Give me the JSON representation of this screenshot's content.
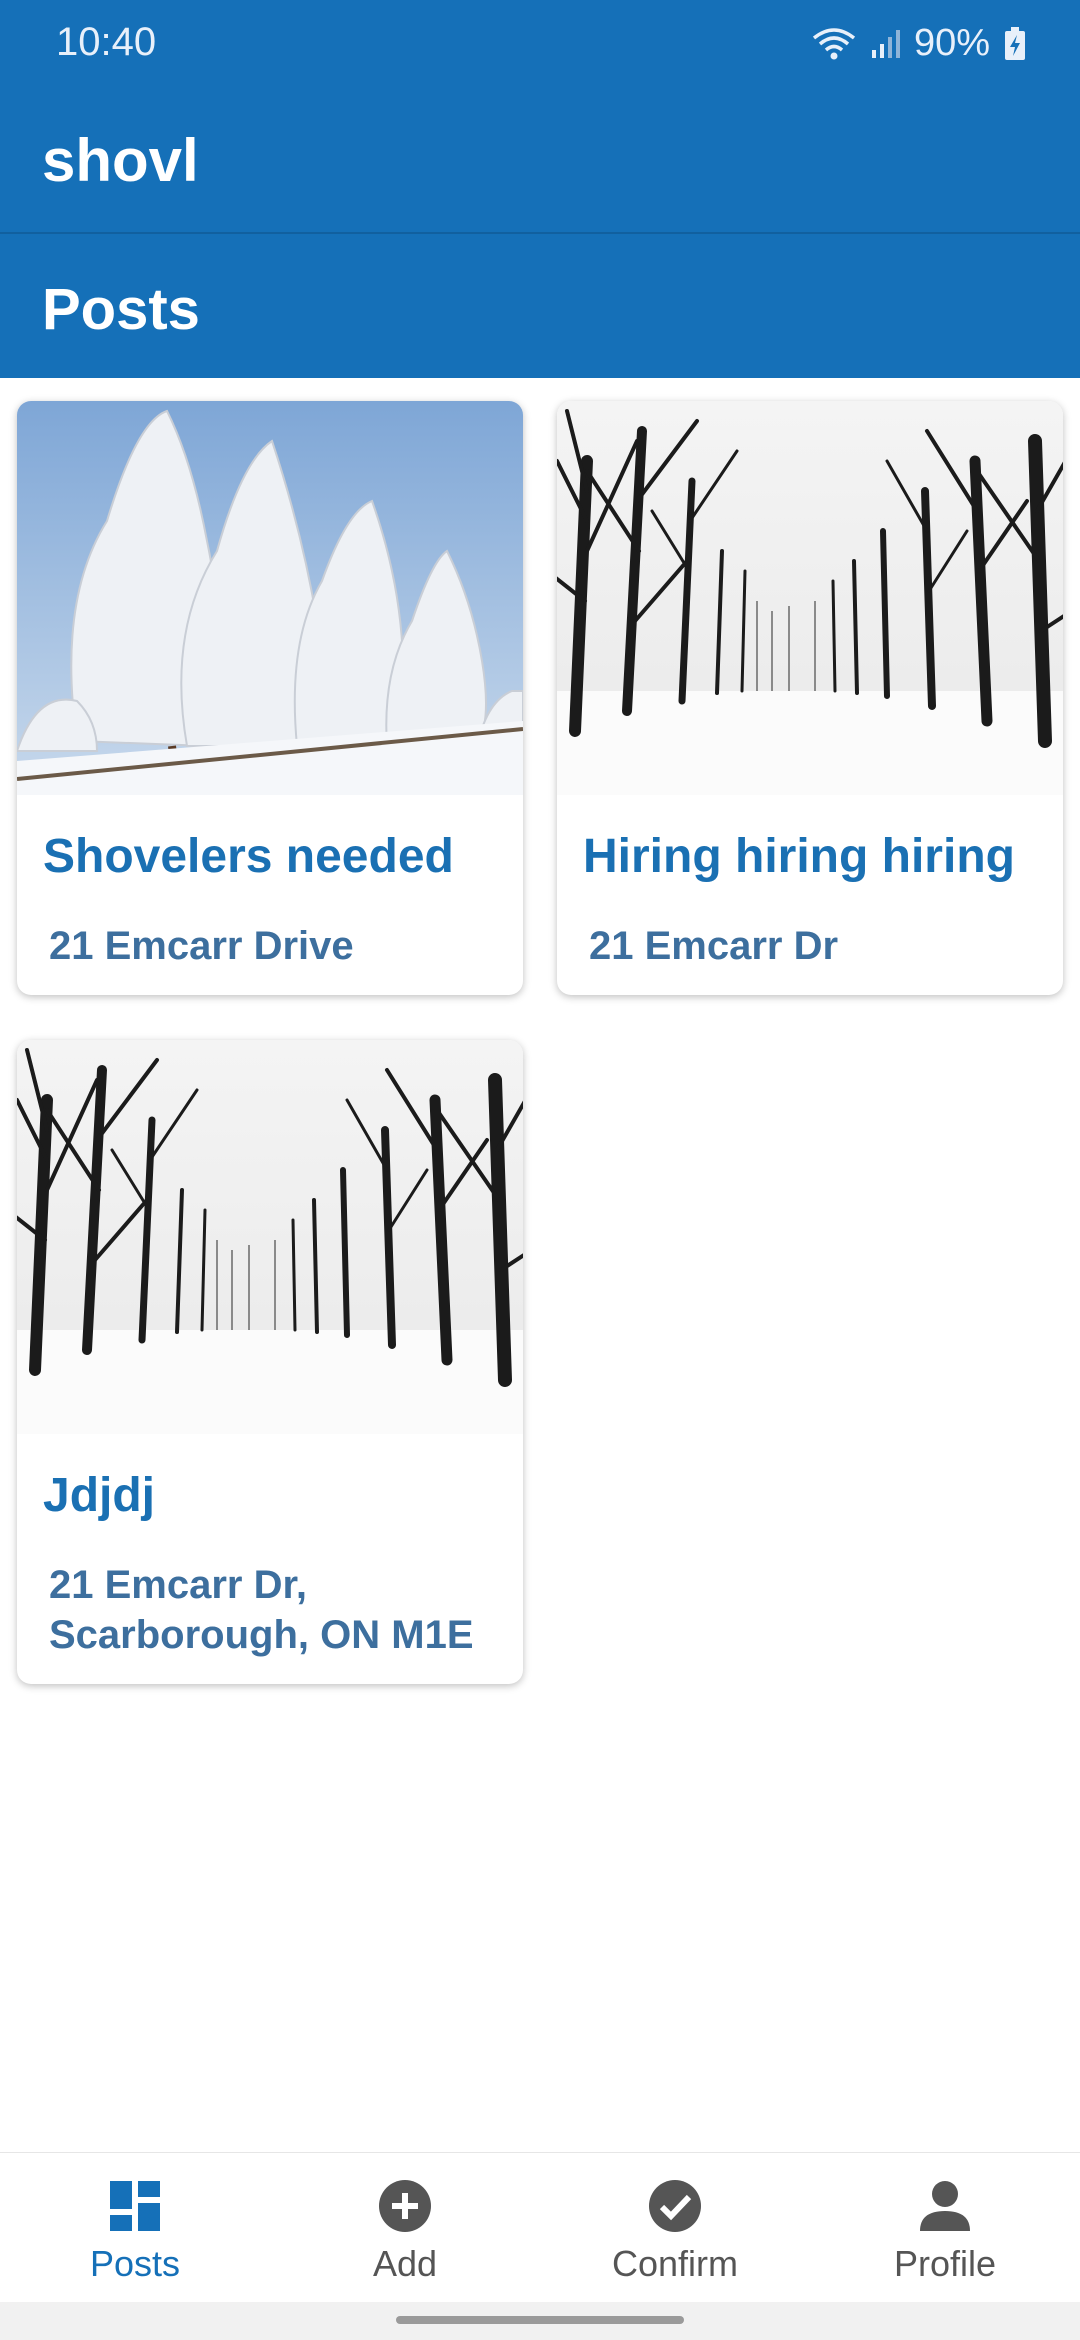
{
  "status_bar": {
    "time": "10:40",
    "battery": "90%"
  },
  "app_bar": {
    "title": "shovl"
  },
  "section": {
    "title": "Posts"
  },
  "posts": [
    {
      "title": "Shovelers needed",
      "address": "21 Emcarr Drive",
      "image": "frosted-trees-photo"
    },
    {
      "title": "Hiring hiring hiring",
      "address": "21 Emcarr Dr",
      "image": "snowy-tree-avenue-photo"
    },
    {
      "title": "Jdjdj",
      "address": "21 Emcarr Dr, Scarborough, ON M1E",
      "image": "snowy-tree-avenue-photo"
    }
  ],
  "nav": [
    {
      "label": "Posts",
      "icon": "dashboard-icon",
      "active": true
    },
    {
      "label": "Add",
      "icon": "add-circle-icon",
      "active": false
    },
    {
      "label": "Confirm",
      "icon": "check-circle-icon",
      "active": false
    },
    {
      "label": "Profile",
      "icon": "person-icon",
      "active": false
    }
  ],
  "colors": {
    "primary": "#1570b8",
    "card_title": "#1a70b3",
    "card_address": "#3d6f9e",
    "nav_inactive": "#555555"
  }
}
